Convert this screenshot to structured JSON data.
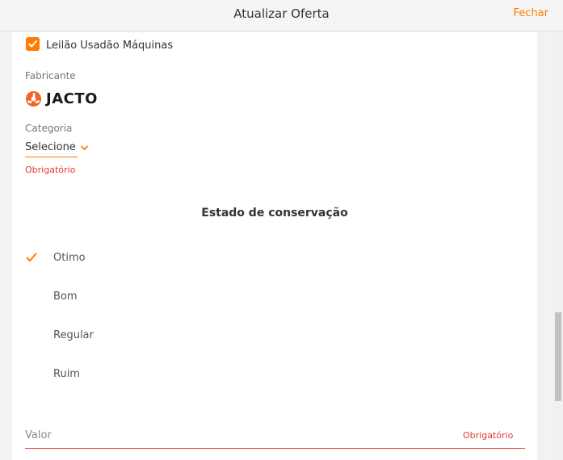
{
  "header": {
    "title": "Atualizar Oferta",
    "close_label": "Fechar"
  },
  "auction_checkbox": {
    "label": "Leilão Usadão Máquinas",
    "checked": true
  },
  "manufacturer": {
    "label": "Fabricante",
    "brand": "JACTO",
    "brand_icon": "jacto-logo-icon"
  },
  "category": {
    "label": "Categoria",
    "value": "Selecione",
    "required_text": "Obrigatório"
  },
  "condition": {
    "title": "Estado de conservação",
    "options": [
      {
        "label": "Otimo",
        "selected": true
      },
      {
        "label": "Bom",
        "selected": false
      },
      {
        "label": "Regular",
        "selected": false
      },
      {
        "label": "Ruim",
        "selected": false
      }
    ]
  },
  "value_field": {
    "label": "Valor",
    "required_text": "Obrigatório"
  },
  "colors": {
    "accent": "#ff7a00",
    "error": "#e53935"
  }
}
